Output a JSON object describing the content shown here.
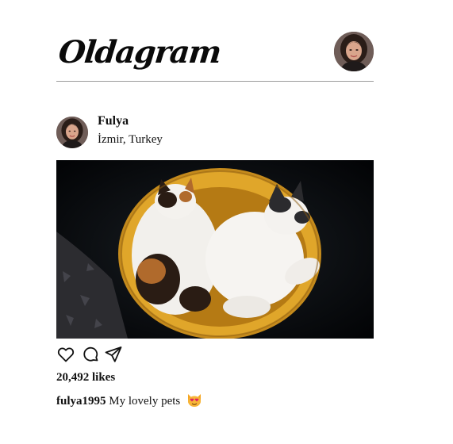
{
  "header": {
    "logo_text": "Oldagram",
    "avatar_icon": "user-avatar"
  },
  "post": {
    "author_name": "Fulya",
    "location": "İzmir, Turkey",
    "photo_icon": "cats-sleeping-in-basket",
    "actions": [
      {
        "name": "like",
        "icon": "heart-icon"
      },
      {
        "name": "comment",
        "icon": "comment-icon"
      },
      {
        "name": "share",
        "icon": "send-icon"
      }
    ],
    "likes_text": "20,492 likes",
    "caption": {
      "username": "fulya1995",
      "text": "My lovely pets",
      "emoji_icon": "heart-eyes-cat-emoji"
    }
  },
  "colors": {
    "background": "#ffffff",
    "divider": "#9a9a9a",
    "text": "#111111",
    "basket": "#d9a128"
  }
}
